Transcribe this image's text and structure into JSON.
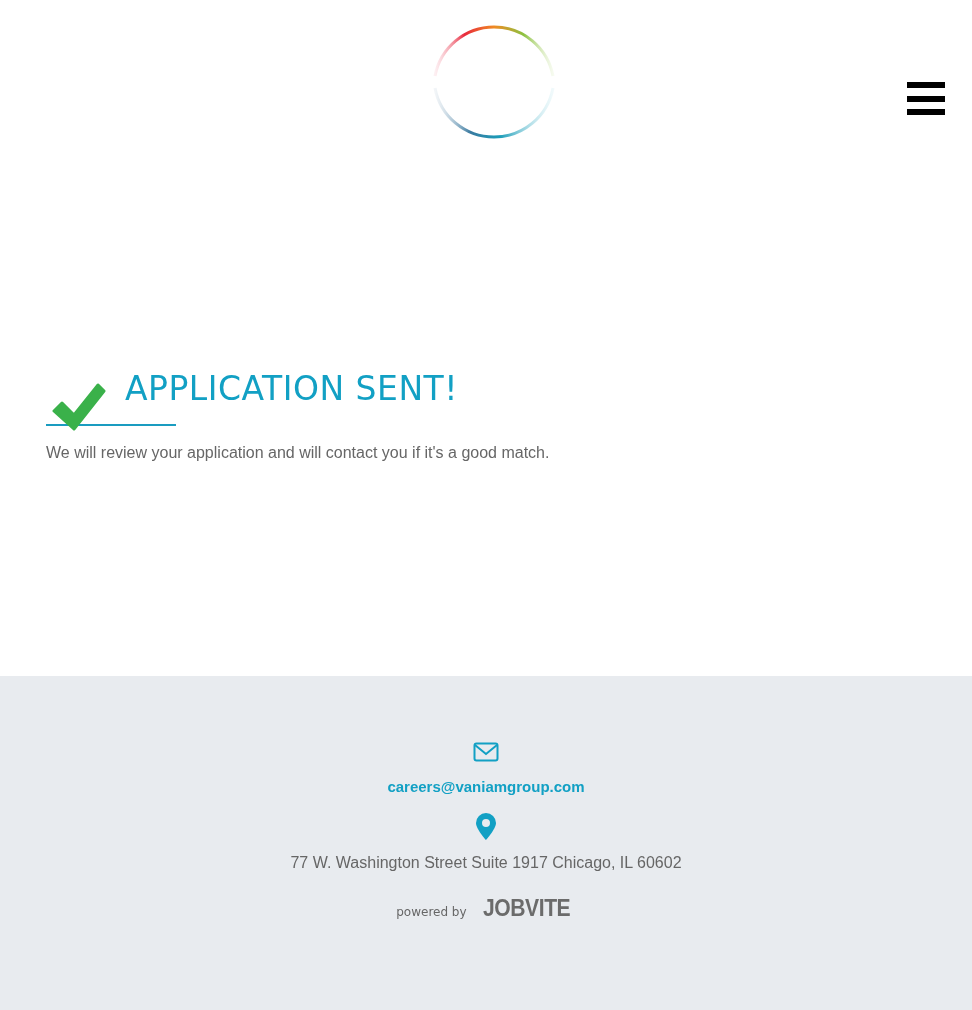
{
  "confirmation": {
    "title": "APPLICATION SENT!",
    "message": "We will review your application and will contact you if it's a good match."
  },
  "footer": {
    "email": "careers@vaniamgroup.com",
    "address": "77 W. Washington Street Suite 1917 Chicago, IL 60602",
    "powered_by": "powered by",
    "brand": "JOBVITE"
  }
}
